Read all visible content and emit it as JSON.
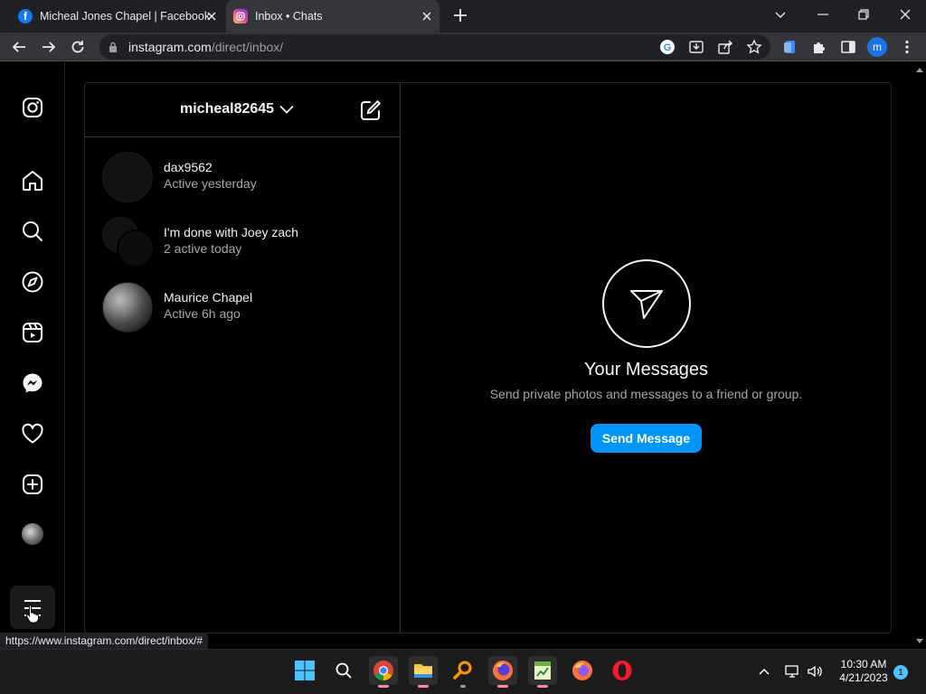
{
  "browser": {
    "tabs": [
      {
        "title": "Micheal Jones Chapel | Facebook",
        "active": false,
        "icon": "facebook-icon"
      },
      {
        "title": "Inbox • Chats",
        "active": true,
        "icon": "instagram-icon"
      }
    ],
    "url_host": "instagram.com",
    "url_path": "/direct/inbox/",
    "profile_initial": "m",
    "status_url": "https://www.instagram.com/direct/inbox/#"
  },
  "nav": {
    "items": [
      "instagram-logo-icon",
      "home-icon",
      "search-icon",
      "explore-icon",
      "reels-icon",
      "messenger-icon",
      "heart-icon",
      "create-icon",
      "profile-avatar",
      "more-menu-icon"
    ]
  },
  "inbox": {
    "username": "micheal82645",
    "threads": [
      {
        "name": "dax9562",
        "status": "Active yesterday"
      },
      {
        "name": "I'm done with Joey zach",
        "status": "2 active today"
      },
      {
        "name": "Maurice Chapel",
        "status": "Active 6h ago"
      }
    ]
  },
  "empty_state": {
    "title": "Your Messages",
    "subtitle": "Send private photos and messages to a friend or group.",
    "button": "Send Message"
  },
  "taskbar": {
    "time": "10:30 AM",
    "date": "4/21/2023",
    "notifications": "1"
  },
  "colors": {
    "accent": "#0095f6",
    "background": "#000000"
  }
}
